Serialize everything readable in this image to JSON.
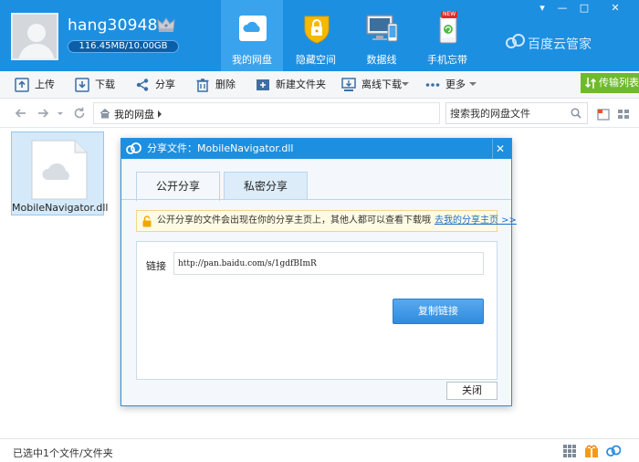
{
  "window": {
    "minimize": "—",
    "restore": "□",
    "close": "✕"
  },
  "header": {
    "username": "hang30948...",
    "quota": "116.45MB/10.00GB",
    "brand": "百度云管家",
    "nav_tabs": [
      {
        "label": "我的网盘",
        "icon": "cloud-drive-icon",
        "active": true
      },
      {
        "label": "隐藏空间",
        "icon": "lock-safe-icon",
        "active": false
      },
      {
        "label": "数据线",
        "icon": "monitor-device-icon",
        "active": false
      },
      {
        "label": "手机忘带",
        "icon": "phone-sync-icon",
        "active": false,
        "badge": "NEW"
      }
    ]
  },
  "toolbar": {
    "upload": "上传",
    "download": "下载",
    "share": "分享",
    "delete": "删除",
    "new_folder": "新建文件夹",
    "offline_download": "离线下载",
    "more": "更多",
    "transfer_list": "传输列表"
  },
  "addressbar": {
    "path": "我的网盘",
    "search_placeholder": "搜索我的网盘文件"
  },
  "files": [
    {
      "name": "MobileNavigator.dll",
      "selected": true
    }
  ],
  "dialog": {
    "title": "分享文件：MobileNavigator.dll",
    "tabs": [
      {
        "label": "公开分享",
        "active": true
      },
      {
        "label": "私密分享",
        "active": false
      }
    ],
    "notice": "公开分享的文件会出现在你的分享主页上，其他人都可以查看下载哦",
    "notice_link": "去我的分享主页 >>",
    "link_label": "链接",
    "link_value": "http://pan.baidu.com/s/1gdfBImR",
    "copy_button": "复制链接",
    "close_button": "关闭"
  },
  "status": {
    "text": "已选中1个文件/文件夹"
  },
  "colors": {
    "header_blue": "#1d8fe0",
    "active_tab": "#3aa3ee",
    "transfer_green": "#6fba2c",
    "link_blue": "#1d6fc9"
  }
}
